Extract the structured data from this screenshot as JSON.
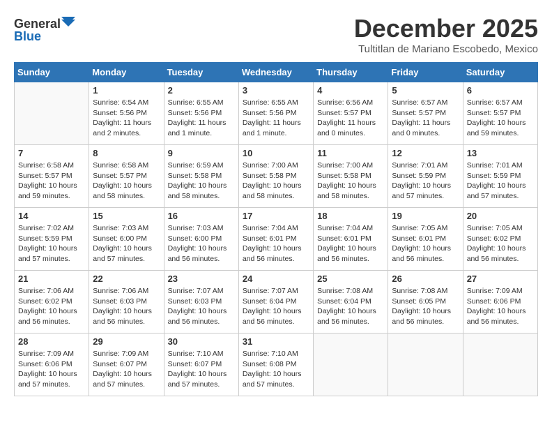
{
  "header": {
    "logo_line1": "General",
    "logo_line2": "Blue",
    "month": "December 2025",
    "location": "Tultitlan de Mariano Escobedo, Mexico"
  },
  "weekdays": [
    "Sunday",
    "Monday",
    "Tuesday",
    "Wednesday",
    "Thursday",
    "Friday",
    "Saturday"
  ],
  "weeks": [
    [
      {
        "day": "",
        "info": ""
      },
      {
        "day": "1",
        "info": "Sunrise: 6:54 AM\nSunset: 5:56 PM\nDaylight: 11 hours\nand 2 minutes."
      },
      {
        "day": "2",
        "info": "Sunrise: 6:55 AM\nSunset: 5:56 PM\nDaylight: 11 hours\nand 1 minute."
      },
      {
        "day": "3",
        "info": "Sunrise: 6:55 AM\nSunset: 5:56 PM\nDaylight: 11 hours\nand 1 minute."
      },
      {
        "day": "4",
        "info": "Sunrise: 6:56 AM\nSunset: 5:57 PM\nDaylight: 11 hours\nand 0 minutes."
      },
      {
        "day": "5",
        "info": "Sunrise: 6:57 AM\nSunset: 5:57 PM\nDaylight: 11 hours\nand 0 minutes."
      },
      {
        "day": "6",
        "info": "Sunrise: 6:57 AM\nSunset: 5:57 PM\nDaylight: 10 hours\nand 59 minutes."
      }
    ],
    [
      {
        "day": "7",
        "info": "Sunrise: 6:58 AM\nSunset: 5:57 PM\nDaylight: 10 hours\nand 59 minutes."
      },
      {
        "day": "8",
        "info": "Sunrise: 6:58 AM\nSunset: 5:57 PM\nDaylight: 10 hours\nand 58 minutes."
      },
      {
        "day": "9",
        "info": "Sunrise: 6:59 AM\nSunset: 5:58 PM\nDaylight: 10 hours\nand 58 minutes."
      },
      {
        "day": "10",
        "info": "Sunrise: 7:00 AM\nSunset: 5:58 PM\nDaylight: 10 hours\nand 58 minutes."
      },
      {
        "day": "11",
        "info": "Sunrise: 7:00 AM\nSunset: 5:58 PM\nDaylight: 10 hours\nand 58 minutes."
      },
      {
        "day": "12",
        "info": "Sunrise: 7:01 AM\nSunset: 5:59 PM\nDaylight: 10 hours\nand 57 minutes."
      },
      {
        "day": "13",
        "info": "Sunrise: 7:01 AM\nSunset: 5:59 PM\nDaylight: 10 hours\nand 57 minutes."
      }
    ],
    [
      {
        "day": "14",
        "info": "Sunrise: 7:02 AM\nSunset: 5:59 PM\nDaylight: 10 hours\nand 57 minutes."
      },
      {
        "day": "15",
        "info": "Sunrise: 7:03 AM\nSunset: 6:00 PM\nDaylight: 10 hours\nand 57 minutes."
      },
      {
        "day": "16",
        "info": "Sunrise: 7:03 AM\nSunset: 6:00 PM\nDaylight: 10 hours\nand 56 minutes."
      },
      {
        "day": "17",
        "info": "Sunrise: 7:04 AM\nSunset: 6:01 PM\nDaylight: 10 hours\nand 56 minutes."
      },
      {
        "day": "18",
        "info": "Sunrise: 7:04 AM\nSunset: 6:01 PM\nDaylight: 10 hours\nand 56 minutes."
      },
      {
        "day": "19",
        "info": "Sunrise: 7:05 AM\nSunset: 6:01 PM\nDaylight: 10 hours\nand 56 minutes."
      },
      {
        "day": "20",
        "info": "Sunrise: 7:05 AM\nSunset: 6:02 PM\nDaylight: 10 hours\nand 56 minutes."
      }
    ],
    [
      {
        "day": "21",
        "info": "Sunrise: 7:06 AM\nSunset: 6:02 PM\nDaylight: 10 hours\nand 56 minutes."
      },
      {
        "day": "22",
        "info": "Sunrise: 7:06 AM\nSunset: 6:03 PM\nDaylight: 10 hours\nand 56 minutes."
      },
      {
        "day": "23",
        "info": "Sunrise: 7:07 AM\nSunset: 6:03 PM\nDaylight: 10 hours\nand 56 minutes."
      },
      {
        "day": "24",
        "info": "Sunrise: 7:07 AM\nSunset: 6:04 PM\nDaylight: 10 hours\nand 56 minutes."
      },
      {
        "day": "25",
        "info": "Sunrise: 7:08 AM\nSunset: 6:04 PM\nDaylight: 10 hours\nand 56 minutes."
      },
      {
        "day": "26",
        "info": "Sunrise: 7:08 AM\nSunset: 6:05 PM\nDaylight: 10 hours\nand 56 minutes."
      },
      {
        "day": "27",
        "info": "Sunrise: 7:09 AM\nSunset: 6:06 PM\nDaylight: 10 hours\nand 56 minutes."
      }
    ],
    [
      {
        "day": "28",
        "info": "Sunrise: 7:09 AM\nSunset: 6:06 PM\nDaylight: 10 hours\nand 57 minutes."
      },
      {
        "day": "29",
        "info": "Sunrise: 7:09 AM\nSunset: 6:07 PM\nDaylight: 10 hours\nand 57 minutes."
      },
      {
        "day": "30",
        "info": "Sunrise: 7:10 AM\nSunset: 6:07 PM\nDaylight: 10 hours\nand 57 minutes."
      },
      {
        "day": "31",
        "info": "Sunrise: 7:10 AM\nSunset: 6:08 PM\nDaylight: 10 hours\nand 57 minutes."
      },
      {
        "day": "",
        "info": ""
      },
      {
        "day": "",
        "info": ""
      },
      {
        "day": "",
        "info": ""
      }
    ]
  ]
}
